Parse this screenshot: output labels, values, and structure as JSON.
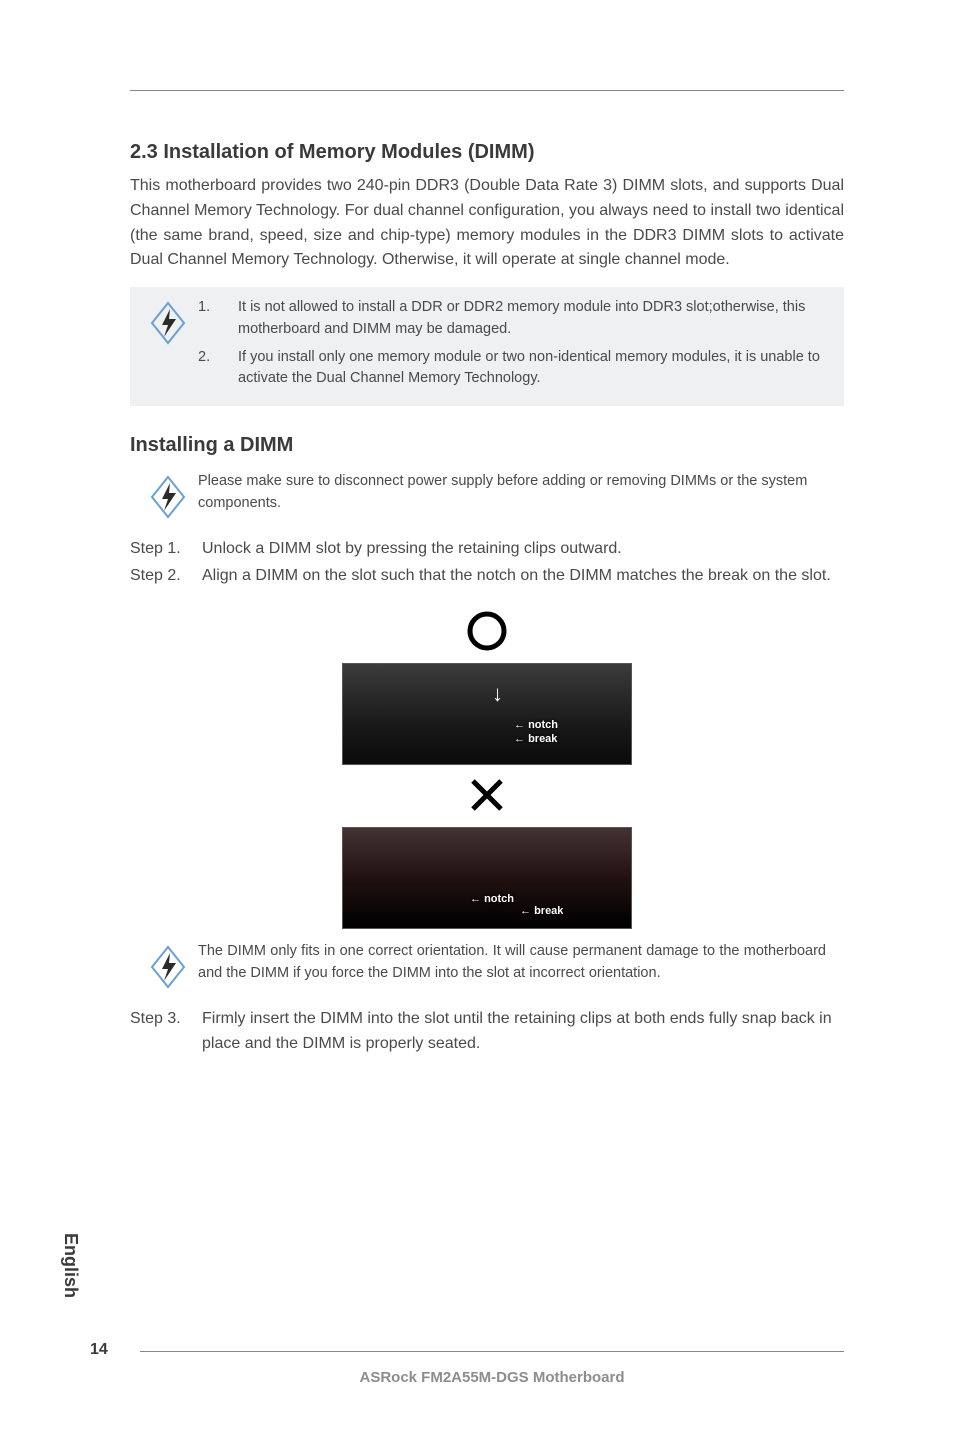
{
  "section": {
    "title": "2.3  Installation of Memory Modules (DIMM)",
    "intro": "This motherboard provides two 240-pin DDR3 (Double Data Rate 3) DIMM slots, and supports Dual Channel Memory Technology. For dual channel configuration, you always need to install two identical (the same brand, speed, size and chip-type) memory modules in the DDR3 DIMM slots to activate Dual Channel Memory Technology. Otherwise, it will operate at single channel mode."
  },
  "note1": {
    "items": [
      {
        "num": "1.",
        "text": "It is not allowed to install a DDR or DDR2 memory module into DDR3 slot;otherwise, this motherboard and DIMM may be damaged."
      },
      {
        "num": "2.",
        "text": "If you install only one memory module or two non-identical memory modules, it is unable to activate the Dual Channel Memory Technology."
      }
    ]
  },
  "install": {
    "heading": "Installing a DIMM",
    "warn": "Please make sure to disconnect power supply before adding or removing DIMMs or the system components.",
    "steps": [
      {
        "label": "Step 1.",
        "text": "Unlock a DIMM slot by pressing the retaining clips outward."
      },
      {
        "label": "Step 2.",
        "text": "Align a DIMM on the slot such that the notch on the DIMM matches the break on the slot."
      }
    ],
    "step3": {
      "label": "Step 3.",
      "text": "Firmly insert the DIMM into the slot until the retaining clips at both ends fully snap back in place and the DIMM is properly seated."
    }
  },
  "imglabels": {
    "notch": "notch",
    "break": "break"
  },
  "note3": "The DIMM only fits in one correct orientation. It will cause permanent damage to the motherboard and the DIMM if you force the DIMM into the slot at incorrect orientation.",
  "side": "English",
  "footer": {
    "page": "14",
    "product": "ASRock  FM2A55M-DGS  Motherboard"
  }
}
